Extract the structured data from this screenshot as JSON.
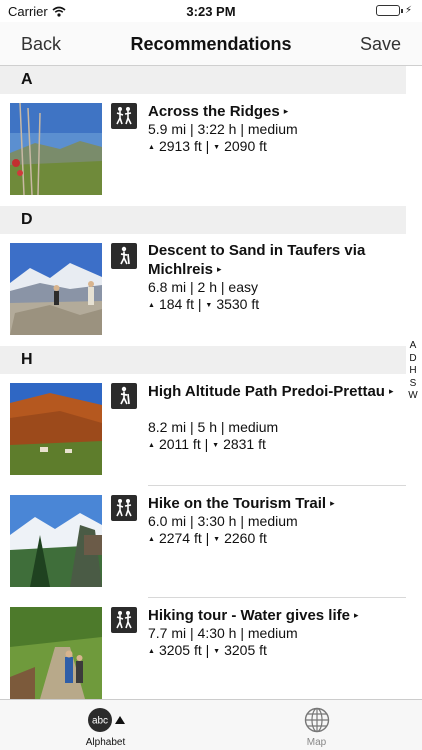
{
  "status": {
    "carrier": "Carrier",
    "time": "3:23 PM"
  },
  "nav": {
    "back": "Back",
    "title": "Recommendations",
    "save": "Save"
  },
  "sections": [
    {
      "letter": "A"
    },
    {
      "letter": "D"
    },
    {
      "letter": "H"
    }
  ],
  "rows": [
    {
      "title": "Across the Ridges",
      "line1": "5.9 mi | 3:22 h | medium",
      "ascent": "2913 ft |",
      "descent": "2090 ft",
      "icon": "hiking-pair-icon",
      "photo": "meadow-flowers-photo"
    },
    {
      "title": "Descent to Sand in Taufers via Michlreis",
      "line1": "6.8 mi | 2 h | easy",
      "ascent": "184 ft |",
      "descent": "3530 ft",
      "icon": "hiker-icon",
      "photo": "hikers-on-rocks-photo"
    },
    {
      "title": "High Altitude Path Predoi-Prettau",
      "line1": "8.2 mi | 5 h | medium",
      "ascent": "2011 ft |",
      "descent": "2831 ft",
      "icon": "hiker-icon",
      "photo": "autumn-valley-photo"
    },
    {
      "title": "Hike on the Tourism Trail",
      "line1": "6.0 mi | 3:30 h | medium",
      "ascent": "2274 ft |",
      "descent": "2260 ft",
      "icon": "hiking-pair-icon",
      "photo": "snowy-peaks-photo"
    },
    {
      "title": "Hiking tour - Water gives life",
      "line1": "7.7 mi | 4:30 h | medium",
      "ascent": "3205 ft |",
      "descent": "3205 ft",
      "icon": "hiking-pair-icon",
      "photo": "hikers-on-trail-photo"
    }
  ],
  "arrow_glyph": "▸",
  "up_glyph": "▲",
  "down_glyph": "▼",
  "index_letters": [
    "A",
    "D",
    "H",
    "S",
    "W"
  ],
  "tabs": {
    "alphabet_label": "Alphabet",
    "alphabet_icon_text": "abc",
    "map_label": "Map"
  },
  "colors": {
    "battery": "#4cd964",
    "section_bg": "#efefef",
    "icon_bg": "#2b2b2b"
  }
}
